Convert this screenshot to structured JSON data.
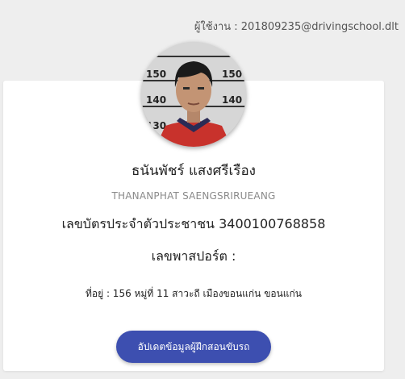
{
  "header": {
    "user_label": "ผู้ใช้งาน : 201809235@drivingschool.dlt"
  },
  "profile": {
    "name_th": "ธนันพัชร์ แสงศรีเรือง",
    "name_en": "THANANPHAT SAENGSRIRUEANG",
    "id_line": "เลขบัตรประจำตัวประชาชน 3400100768858",
    "passport_line": "เลขพาสปอร์ต :",
    "address_line": "ที่อยู่ : 156 หมู่ที่ 11 สาวะถี เมืองขอนแก่น ขอนแก่น",
    "photo_height_marks": [
      "150",
      "140",
      "130",
      "150",
      "140"
    ]
  },
  "actions": {
    "update_label": "อัปเดตข้อมูลผู้ฝึกสอนขับรถ"
  },
  "colors": {
    "background": "#eeeeee",
    "card": "#ffffff",
    "button": "#3d4fb0",
    "button_text": "#ffffff"
  }
}
